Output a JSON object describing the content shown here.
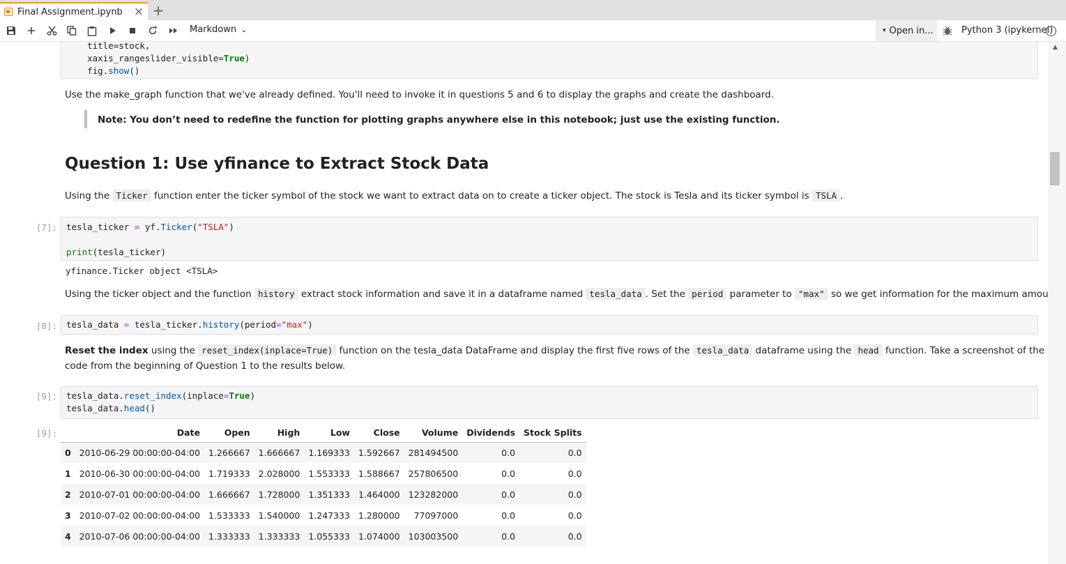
{
  "tab": {
    "title": "Final Assignment.ipynb",
    "close": "×",
    "new": "+"
  },
  "toolbar": {
    "cell_type": "Markdown",
    "cell_type_chevron": "⌄",
    "open_in": "Open in...",
    "open_in_caret": "▾",
    "kernel": "Python 3 (ipykernel)"
  },
  "cells": {
    "top_code": [
      "    title=stock,",
      "    xaxis_rangeslider_visible=True)",
      "    fig.show()"
    ],
    "intro_text": "Use the make_graph function that we've already defined. You'll need to invoke it in questions 5 and 6 to display the graphs and create the dashboard.",
    "note": "Note: You don’t need to redefine the function for plotting graphs anywhere else in this notebook; just use the existing function.",
    "heading": "Question 1: Use yfinance to Extract Stock Data",
    "q1_text": {
      "a": "Using the ",
      "code1": "Ticker",
      "b": " function enter the ticker symbol of the stock we want to extract data on to create a ticker object. The stock is Tesla and its ticker symbol is ",
      "code2": "TSLA",
      "c": "."
    },
    "cell7": {
      "prompt": "[7]:",
      "line1": "tesla_ticker = yf.Ticker(\"TSLA\")",
      "line2": "",
      "line3": "print(tesla_ticker)",
      "output": "yfinance.Ticker object <TSLA>"
    },
    "history_text": {
      "a": "Using the ticker object and the function ",
      "code1": "history",
      "b": " extract stock information and save it in a dataframe named ",
      "code2": "tesla_data",
      "c": ". Set the ",
      "code3": "period",
      "d": " parameter to ",
      "code4": "\"max\"",
      "e": " so we get information for the maximum amount of time."
    },
    "cell8": {
      "prompt": "[8]:",
      "line1": "tesla_data = tesla_ticker.history(period=\"max\")"
    },
    "reset_text": {
      "bold": "Reset the index",
      "a": " using the ",
      "code1": "reset_index(inplace=True)",
      "b": " function on the tesla_data DataFrame and display the first five rows of the ",
      "code2": "tesla_data",
      "c": " dataframe using the ",
      "code3": "head",
      "d": " function. Take a screenshot of the results and",
      "line2": "code from the beginning of Question 1 to the results below."
    },
    "cell9": {
      "prompt": "[9]:",
      "line1": "tesla_data.reset_index(inplace=True)",
      "line2": "tesla_data.head()",
      "out_prompt": "[9]:"
    }
  },
  "dataframe": {
    "columns": [
      "",
      "Date",
      "Open",
      "High",
      "Low",
      "Close",
      "Volume",
      "Dividends",
      "Stock Splits"
    ],
    "rows": [
      [
        "0",
        "2010-06-29 00:00:00-04:00",
        "1.266667",
        "1.666667",
        "1.169333",
        "1.592667",
        "281494500",
        "0.0",
        "0.0"
      ],
      [
        "1",
        "2010-06-30 00:00:00-04:00",
        "1.719333",
        "2.028000",
        "1.553333",
        "1.588667",
        "257806500",
        "0.0",
        "0.0"
      ],
      [
        "2",
        "2010-07-01 00:00:00-04:00",
        "1.666667",
        "1.728000",
        "1.351333",
        "1.464000",
        "123282000",
        "0.0",
        "0.0"
      ],
      [
        "3",
        "2010-07-02 00:00:00-04:00",
        "1.533333",
        "1.540000",
        "1.247333",
        "1.280000",
        "77097000",
        "0.0",
        "0.0"
      ],
      [
        "4",
        "2010-07-06 00:00:00-04:00",
        "1.333333",
        "1.333333",
        "1.055333",
        "1.074000",
        "103003500",
        "0.0",
        "0.0"
      ]
    ]
  },
  "icons": [
    "notebook-icon",
    "save-icon",
    "add-icon",
    "cut-icon",
    "copy-icon",
    "paste-icon",
    "run-icon",
    "stop-icon",
    "restart-icon",
    "run-all-icon",
    "bug-icon",
    "kernel-status-icon"
  ]
}
